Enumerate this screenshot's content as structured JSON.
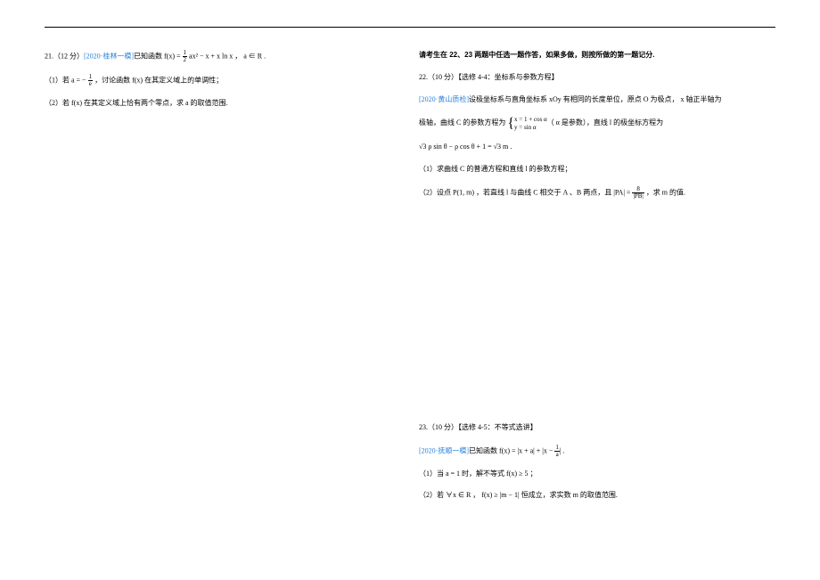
{
  "q21": {
    "header_prefix": "21.（12 分）",
    "source": "[2020·桂林一模]",
    "header_suffix_a": "已知函数 f(x) = ",
    "frac1n": "1",
    "frac1d": "2",
    "header_suffix_b": " ax² − x + x ln x ， a ∈ R .",
    "part1_a": "（1）若 a = − ",
    "part1_frac_n": "1",
    "part1_frac_d": "e",
    "part1_b": " ，讨论函数 f(x) 在其定义域上的单调性；",
    "part2": "（2）若 f(x) 在其定义域上恰有两个零点，求 a 的取值范围."
  },
  "instruction": "请考生在 22、23 两题中任选一题作答，如果多做，则按所做的第一题记分.",
  "q22": {
    "header": "22.（10 分）【选修 4-4：坐标系与参数方程】",
    "source": "[2020·黄山质检]",
    "l1": "设极坐标系与直角坐标系 xOy 有相同的长度单位，原点 O 为极点， x 轴正半轴为",
    "l2a": "极轴，曲线 C 的参数方程为 ",
    "case_top": "x = 1 + cos α",
    "case_bot": "y = sin α",
    "l2b": "（ α 是参数），直线 l 的极坐标方程为",
    "eq": "√3 ρ sin θ − ρ cos θ + 1 = √3 m .",
    "p1": "（1）求曲线 C 的普通方程和直线 l 的参数方程；",
    "p2a": "（2）设点 P(1, m) ，若直线 l 与曲线 C 相交于 A 、B 两点，且 |PA| = ",
    "p2_frac_n": "8",
    "p2_frac_d": "|PB|",
    "p2b": " ，求 m 的值."
  },
  "q23": {
    "header": "23.（10 分）【选修 4-5：不等式选讲】",
    "source": "[2020·抚顺一模]",
    "l1a": "已知函数 f(x) = |x + a| + |x − ",
    "frac_n": "1",
    "frac_d": "a",
    "l1b": "| .",
    "p1": "（1）当 a = 1 时，解不等式 f(x) ≥ 5 ；",
    "p2": "（2）若 ∀x ∈ R ， f(x) ≥ |m − 1| 恒成立，求实数 m 的取值范围."
  }
}
